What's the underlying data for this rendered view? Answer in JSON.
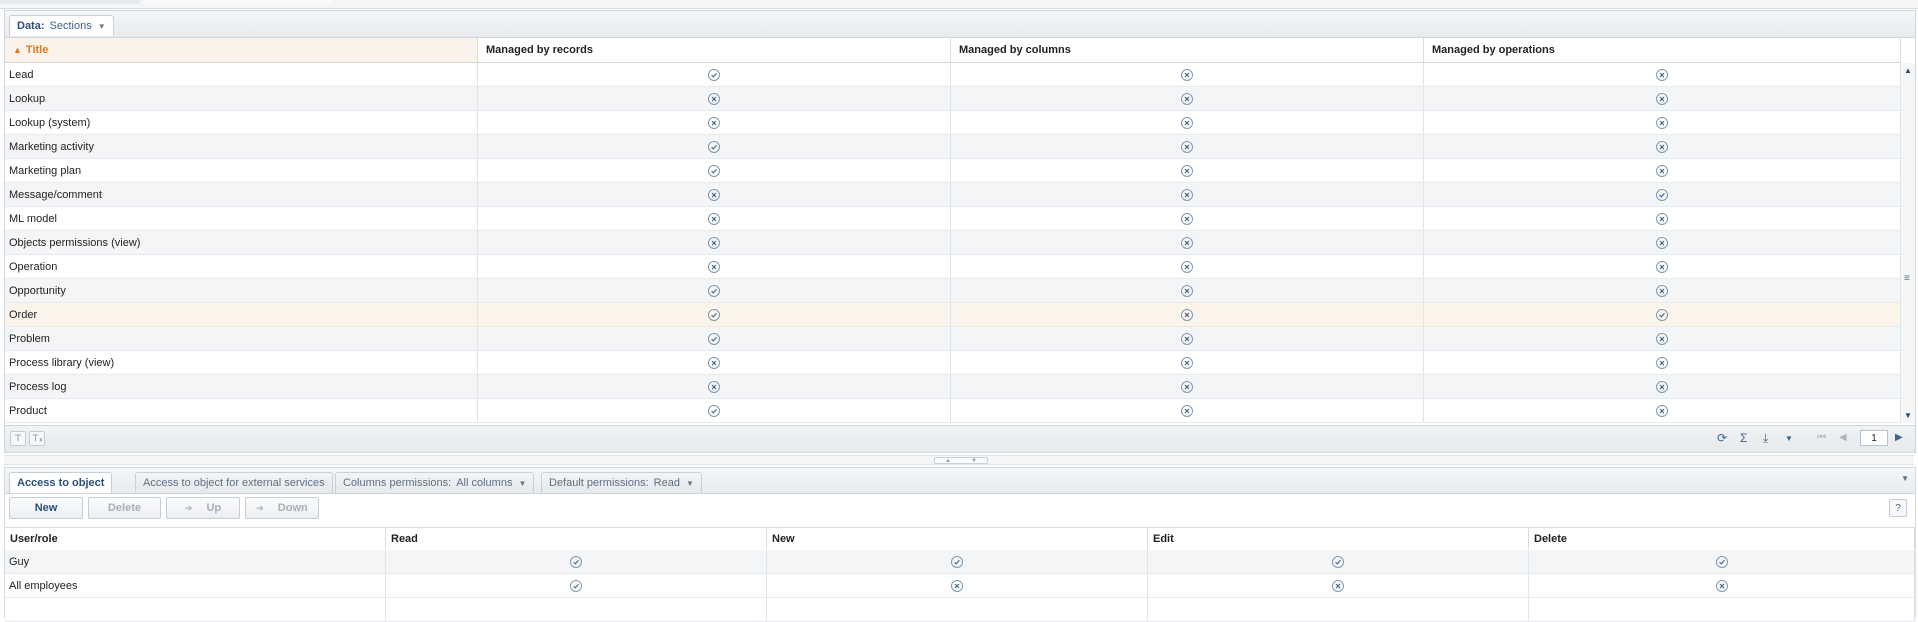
{
  "sections_panel": {
    "tab": {
      "label": "Data:",
      "value": "Sections"
    },
    "columns": [
      "Title",
      "Managed by records",
      "Managed by columns",
      "Managed by operations"
    ],
    "rows": [
      {
        "title": "Lead",
        "records": true,
        "columns": false,
        "operations": false
      },
      {
        "title": "Lookup",
        "records": false,
        "columns": false,
        "operations": false
      },
      {
        "title": "Lookup (system)",
        "records": false,
        "columns": false,
        "operations": false
      },
      {
        "title": "Marketing activity",
        "records": true,
        "columns": false,
        "operations": false
      },
      {
        "title": "Marketing plan",
        "records": true,
        "columns": false,
        "operations": false
      },
      {
        "title": "Message/comment",
        "records": false,
        "columns": false,
        "operations": true
      },
      {
        "title": "ML model",
        "records": false,
        "columns": false,
        "operations": false
      },
      {
        "title": "Objects permissions (view)",
        "records": false,
        "columns": false,
        "operations": false
      },
      {
        "title": "Operation",
        "records": false,
        "columns": false,
        "operations": false
      },
      {
        "title": "Opportunity",
        "records": true,
        "columns": false,
        "operations": false
      },
      {
        "title": "Order",
        "records": true,
        "columns": false,
        "operations": true
      },
      {
        "title": "Problem",
        "records": true,
        "columns": false,
        "operations": false
      },
      {
        "title": "Process library (view)",
        "records": false,
        "columns": false,
        "operations": false
      },
      {
        "title": "Process log",
        "records": false,
        "columns": false,
        "operations": false
      },
      {
        "title": "Product",
        "records": true,
        "columns": false,
        "operations": false
      }
    ],
    "selected_row": "Order",
    "page_number": "1"
  },
  "access_panel": {
    "tabs": [
      {
        "label": "Access to object"
      },
      {
        "label": "Access to object for external services"
      },
      {
        "label": "Columns permissions:",
        "value": "All columns"
      },
      {
        "label": "Default permissions:",
        "value": "Read"
      }
    ],
    "toolbar": {
      "new": "New",
      "delete": "Delete",
      "up": "Up",
      "down": "Down"
    },
    "columns": [
      "User/role",
      "Read",
      "New",
      "Edit",
      "Delete"
    ],
    "rows": [
      {
        "user": "Guy",
        "read": true,
        "new": true,
        "edit": true,
        "delete": true
      },
      {
        "user": "All employees",
        "read": true,
        "new": false,
        "edit": false,
        "delete": false
      }
    ]
  },
  "colors": {
    "accent": "#e07a1f",
    "link": "#2d4f7a",
    "check": "#7f98b2"
  }
}
